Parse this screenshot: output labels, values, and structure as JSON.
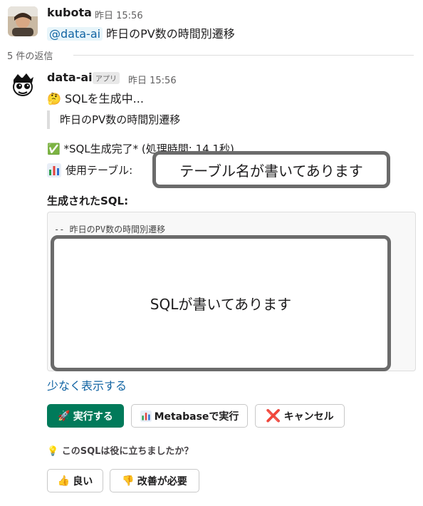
{
  "thread": {
    "parent": {
      "username": "kubota",
      "timestamp": "昨日 15:56",
      "mention": "@data-ai",
      "text": "昨日のPV数の時間別遷移"
    },
    "reply_count_label": "5 件の返信"
  },
  "reply": {
    "username": "data-ai",
    "app_badge": "アプリ",
    "timestamp": "昨日 15:56",
    "thinking_emoji": "🤔",
    "thinking_text": "SQLを生成中...",
    "quote_text": "昨日のPV数の時間別遷移",
    "completed_emoji": "✅",
    "completed_text": "*SQL生成完了* (処理時間: 14.1秒)",
    "table_label": "使用テーブル:",
    "table_overlay": "テーブル名が書いてあります",
    "sql_heading": "生成されたSQL:",
    "sql_comment": "-- 昨日のPV数の時間別遷移",
    "sql_overlay": "SQLが書いてあります",
    "show_less": "少なく表示する",
    "buttons": {
      "run": "実行する",
      "metabase": "Metabaseで実行",
      "cancel": "キャンセル"
    },
    "feedback_question": "このSQLは役に立ちましたか？",
    "feedback": {
      "good": "良い",
      "needs_improvement": "改善が必要"
    }
  },
  "colors": {
    "primary_button": "#007a5a",
    "link": "#1264a3",
    "overlay_border": "#6b6b6b"
  }
}
